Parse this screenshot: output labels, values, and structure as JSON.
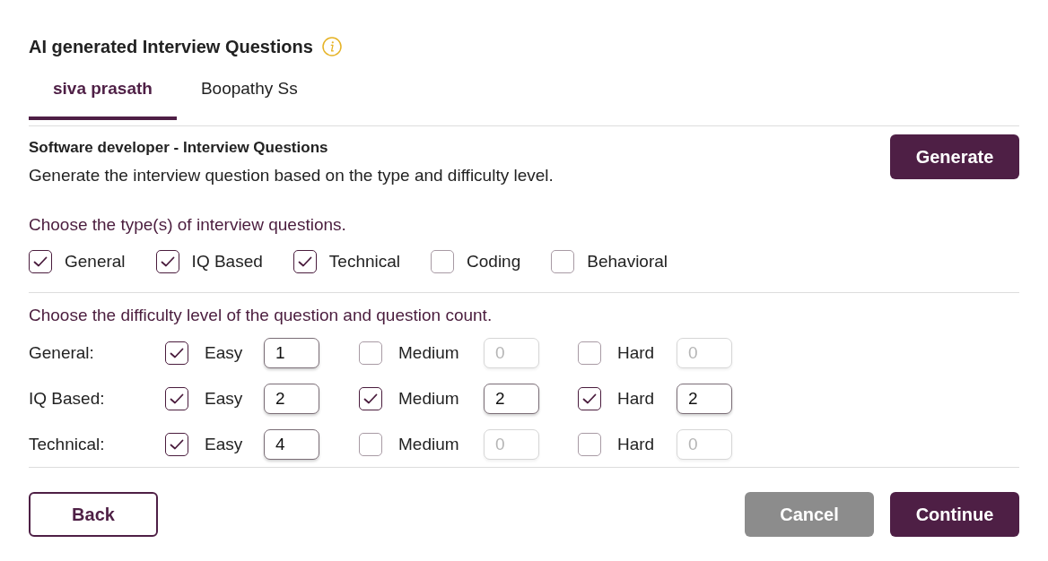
{
  "title": "AI generated Interview Questions",
  "tabs": [
    {
      "label": "siva prasath",
      "selected": true
    },
    {
      "label": "Boopathy Ss",
      "selected": false
    }
  ],
  "header": {
    "title": "Software developer - Interview Questions",
    "description": "Generate the interview question based on the type and difficulty level.",
    "generate_button": "Generate"
  },
  "types": {
    "prompt": "Choose the type(s) of interview questions.",
    "options": [
      {
        "label": "General",
        "checked": true
      },
      {
        "label": "IQ Based",
        "checked": true
      },
      {
        "label": "Technical",
        "checked": true
      },
      {
        "label": "Coding",
        "checked": false
      },
      {
        "label": "Behavioral",
        "checked": false
      }
    ]
  },
  "difficulty": {
    "prompt": "Choose the difficulty level of the question and question count.",
    "rows": [
      {
        "label": "General:",
        "levels": [
          {
            "label": "Easy",
            "checked": true,
            "count": "1"
          },
          {
            "label": "Medium",
            "checked": false,
            "count": "0"
          },
          {
            "label": "Hard",
            "checked": false,
            "count": "0"
          }
        ]
      },
      {
        "label": "IQ Based:",
        "levels": [
          {
            "label": "Easy",
            "checked": true,
            "count": "2"
          },
          {
            "label": "Medium",
            "checked": true,
            "count": "2"
          },
          {
            "label": "Hard",
            "checked": true,
            "count": "2"
          }
        ]
      },
      {
        "label": "Technical:",
        "levels": [
          {
            "label": "Easy",
            "checked": true,
            "count": "4"
          },
          {
            "label": "Medium",
            "checked": false,
            "count": "0"
          },
          {
            "label": "Hard",
            "checked": false,
            "count": "0"
          }
        ]
      }
    ]
  },
  "buttons": [
    {
      "label": "Back",
      "kind": "outline"
    },
    {
      "label": "Cancel",
      "kind": "muted"
    },
    {
      "label": "Continue",
      "kind": "primary"
    }
  ]
}
